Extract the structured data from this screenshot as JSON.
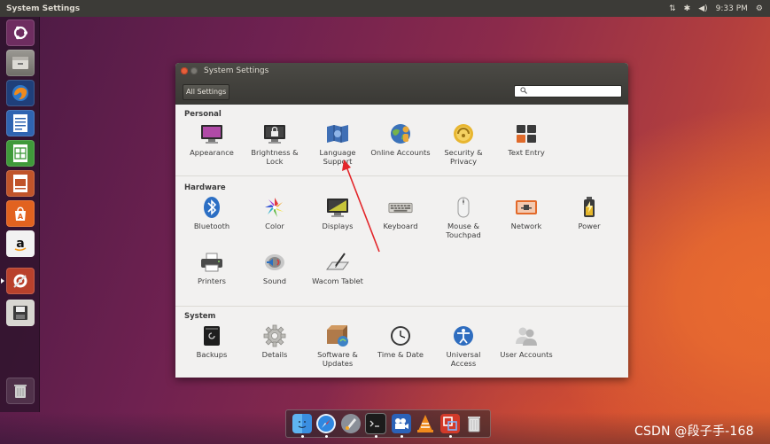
{
  "top_panel": {
    "title": "System Settings",
    "time": "9:33 PM",
    "icons": [
      "network-icon",
      "bluetooth-icon",
      "volume-icon",
      "gear-icon"
    ]
  },
  "window": {
    "title": "System Settings",
    "all_settings_label": "All Settings",
    "search": {
      "value": "",
      "placeholder": ""
    },
    "sections": [
      {
        "title": "Personal",
        "items": [
          {
            "label": "Appearance",
            "icon": "appearance-icon"
          },
          {
            "label": "Brightness & Lock",
            "icon": "brightness-lock-icon"
          },
          {
            "label": "Language Support",
            "icon": "language-support-icon"
          },
          {
            "label": "Online Accounts",
            "icon": "online-accounts-icon"
          },
          {
            "label": "Security & Privacy",
            "icon": "security-privacy-icon"
          },
          {
            "label": "Text Entry",
            "icon": "text-entry-icon"
          }
        ]
      },
      {
        "title": "Hardware",
        "items": [
          {
            "label": "Bluetooth",
            "icon": "bluetooth-icon"
          },
          {
            "label": "Color",
            "icon": "color-icon"
          },
          {
            "label": "Displays",
            "icon": "displays-icon"
          },
          {
            "label": "Keyboard",
            "icon": "keyboard-icon"
          },
          {
            "label": "Mouse & Touchpad",
            "icon": "mouse-icon"
          },
          {
            "label": "Network",
            "icon": "network-icon"
          },
          {
            "label": "Power",
            "icon": "power-icon"
          },
          {
            "label": "Printers",
            "icon": "printer-icon"
          },
          {
            "label": "Sound",
            "icon": "sound-icon"
          },
          {
            "label": "Wacom Tablet",
            "icon": "wacom-tablet-icon"
          }
        ]
      },
      {
        "title": "System",
        "items": [
          {
            "label": "Backups",
            "icon": "backups-icon"
          },
          {
            "label": "Details",
            "icon": "details-gear-icon"
          },
          {
            "label": "Software & Updates",
            "icon": "software-updates-icon"
          },
          {
            "label": "Time & Date",
            "icon": "clock-icon"
          },
          {
            "label": "Universal Access",
            "icon": "universal-access-icon"
          },
          {
            "label": "User Accounts",
            "icon": "user-accounts-icon"
          }
        ]
      }
    ]
  },
  "launcher": [
    "ubuntu-dash-icon",
    "files-icon",
    "firefox-icon",
    "writer-icon",
    "calc-icon",
    "impress-icon",
    "software-center-icon",
    "amazon-icon",
    "system-settings-icon",
    "save-disk-icon",
    "trash-icon"
  ],
  "dock": [
    "finder-icon",
    "safari-icon",
    "launchpad-icon",
    "terminal-icon",
    "video-camera-icon",
    "vlc-icon",
    "parallels-icon",
    "trash-icon"
  ],
  "watermark": "CSDN @段子手-168",
  "colors": {
    "panel": "#3c3b37",
    "accent": "#e95420"
  }
}
